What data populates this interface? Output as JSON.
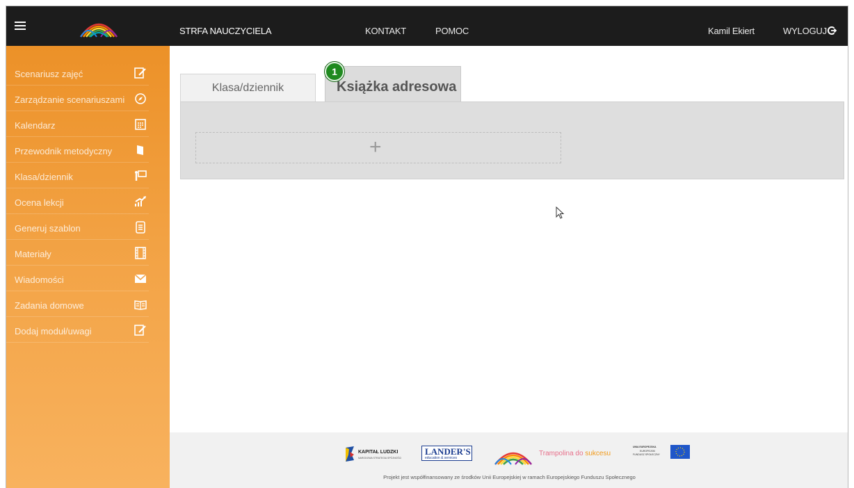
{
  "header": {
    "nav": {
      "strefa": "STRFA NAUCZYCIELA",
      "kontakt": "KONTAKT",
      "pomoc": "POMOC",
      "user": "Kamil Ekiert",
      "logout": "WYLOGUJ"
    }
  },
  "sidebar": {
    "items": [
      {
        "label": "Scenariusz zajęć",
        "icon": "edit-note-icon"
      },
      {
        "label": "Zarządzanie scenariuszami",
        "icon": "compass-icon"
      },
      {
        "label": "Kalendarz",
        "icon": "calendar-icon"
      },
      {
        "label": "Przewodnik metodyczny",
        "icon": "book-icon"
      },
      {
        "label": "Klasa/dziennik",
        "icon": "presentation-icon"
      },
      {
        "label": "Ocena lekcji",
        "icon": "growth-chart-icon"
      },
      {
        "label": "Generuj szablon",
        "icon": "document-icon"
      },
      {
        "label": "Materiały",
        "icon": "film-icon"
      },
      {
        "label": "Wiadomości",
        "icon": "envelope-icon"
      },
      {
        "label": "Zadania domowe",
        "icon": "open-book-icon"
      },
      {
        "label": "Dodaj moduł/uwagi",
        "icon": "edit-note-icon"
      }
    ]
  },
  "main": {
    "tabs": [
      {
        "label": "Klasa/dziennik"
      },
      {
        "label": "Książka adresowa"
      }
    ],
    "step_badge": "1",
    "add_symbol": "+"
  },
  "footer": {
    "logos": {
      "kapital": "KAPITAŁ LUDZKI",
      "kapital_sub": "NARODOWA STRATEGIA SPÓJNOŚCI",
      "landers": "LANDER'S",
      "landers_sub": "education & services",
      "trampolina_a": "Trampolina do ",
      "trampolina_b": "sukcesu",
      "ue_a": "UNIA EUROPEJSKA",
      "ue_b": "EUROPEJSKI",
      "ue_c": "FUNDUSZ SPOŁECZNY"
    },
    "text": "Projekt jest współfinansowany ze środków Unii Europejskiej w ramach Europejskiego Funduszu Społecznego"
  },
  "colors": {
    "topbar": "#1c1c1c",
    "sidebar": "#f3a447",
    "badge": "#1f8a1f"
  }
}
